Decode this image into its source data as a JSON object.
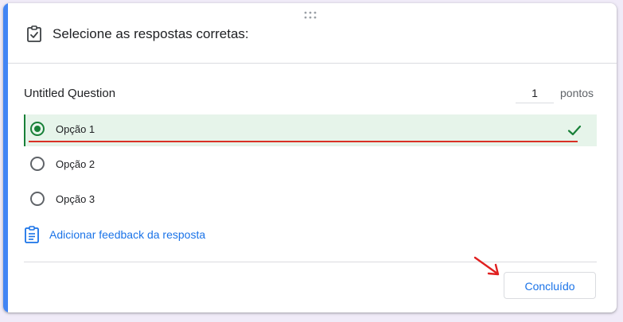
{
  "header": {
    "title": "Selecione as respostas corretas:",
    "icon": "assignment-check-icon"
  },
  "question": {
    "title": "Untitled Question",
    "points_value": "1",
    "points_label": "pontos"
  },
  "options": [
    {
      "label": "Opção 1",
      "selected": true,
      "correct": true
    },
    {
      "label": "Opção 2",
      "selected": false,
      "correct": false
    },
    {
      "label": "Opção 3",
      "selected": false,
      "correct": false
    }
  ],
  "feedback": {
    "label": "Adicionar feedback da resposta",
    "icon": "feedback-icon"
  },
  "actions": {
    "done_label": "Concluído"
  },
  "colors": {
    "accent": "#4285f4",
    "correct_green": "#188038",
    "correct_bg": "#e6f4ea",
    "link_blue": "#1a73e8",
    "annotation_red": "#d93025"
  }
}
